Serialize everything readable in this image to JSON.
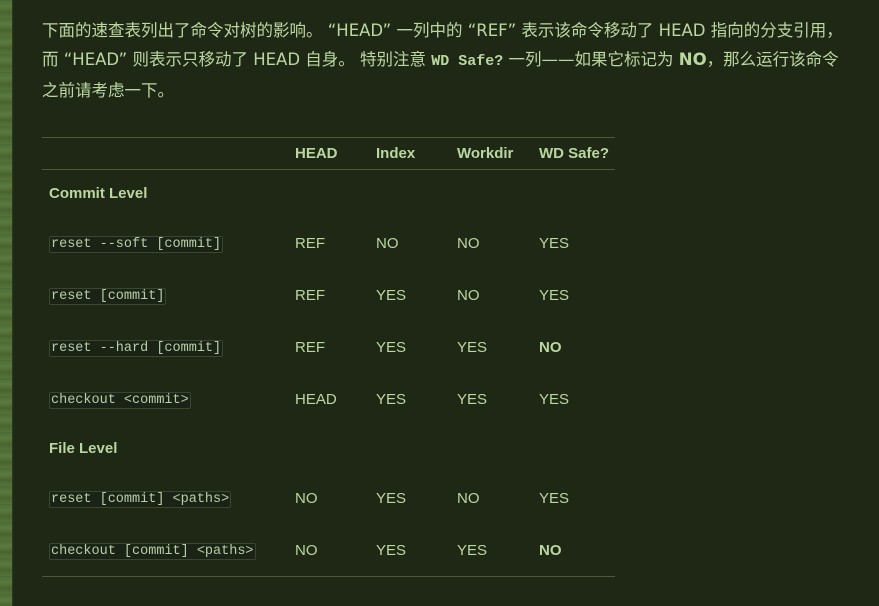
{
  "intro": {
    "part1": "下面的速查表列出了命令对树的影响。 “HEAD” 一列中的 “REF” 表示该命令移动了 HEAD 指向的分支引用，而 “HEAD” 则表示只移动了 HEAD 自身。 特别注意 ",
    "code": "WD Safe?",
    "part2": " 一列——如果它标记为 ",
    "bold": "NO",
    "part3": "，那么运行该命令之前请考虑一下。"
  },
  "table": {
    "headers": [
      "",
      "HEAD",
      "Index",
      "Workdir",
      "WD Safe?"
    ],
    "sections": [
      {
        "title": "Commit Level",
        "rows": [
          {
            "cmd": "reset --soft [commit]",
            "head": "REF",
            "index": "NO",
            "workdir": "NO",
            "wd_safe": "YES"
          },
          {
            "cmd": "reset [commit]",
            "head": "REF",
            "index": "YES",
            "workdir": "NO",
            "wd_safe": "YES"
          },
          {
            "cmd": "reset --hard [commit]",
            "head": "REF",
            "index": "YES",
            "workdir": "YES",
            "wd_safe": "NO"
          },
          {
            "cmd": "checkout <commit>",
            "head": "HEAD",
            "index": "YES",
            "workdir": "YES",
            "wd_safe": "YES"
          }
        ]
      },
      {
        "title": "File Level",
        "rows": [
          {
            "cmd": "reset [commit] <paths>",
            "head": "NO",
            "index": "YES",
            "workdir": "NO",
            "wd_safe": "YES"
          },
          {
            "cmd": "checkout [commit] <paths>",
            "head": "NO",
            "index": "YES",
            "workdir": "YES",
            "wd_safe": "NO"
          }
        ]
      }
    ]
  }
}
